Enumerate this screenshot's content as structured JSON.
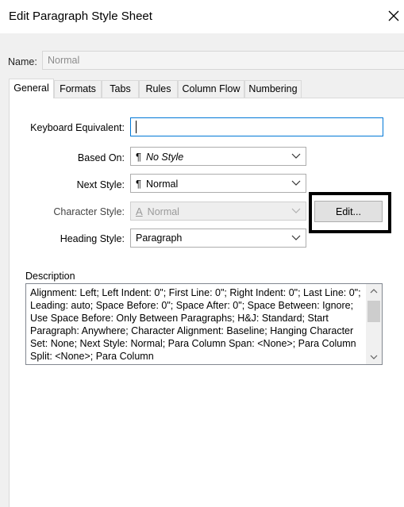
{
  "window": {
    "title": "Edit Paragraph Style Sheet",
    "close_icon": "close-icon"
  },
  "name": {
    "label": "Name:",
    "value": "Normal"
  },
  "tabs": [
    {
      "label": "General",
      "active": true
    },
    {
      "label": "Formats",
      "active": false
    },
    {
      "label": "Tabs",
      "active": false
    },
    {
      "label": "Rules",
      "active": false
    },
    {
      "label": "Column Flow",
      "active": false
    },
    {
      "label": "Numbering",
      "active": false
    }
  ],
  "general": {
    "keyboard_equivalent": {
      "label": "Keyboard Equivalent:",
      "value": ""
    },
    "based_on": {
      "label": "Based On:",
      "icon": "paragraph-icon",
      "value": "No Style"
    },
    "next_style": {
      "label": "Next Style:",
      "icon": "paragraph-icon",
      "value": "Normal"
    },
    "character_style": {
      "label": "Character Style:",
      "icon": "character-style-icon",
      "value": "Normal",
      "disabled": true
    },
    "edit_button": "Edit...",
    "heading_style": {
      "label": "Heading Style:",
      "value": "Paragraph"
    }
  },
  "description": {
    "label": "Description",
    "text": "Alignment: Left;   Left Indent: 0\";   First Line: 0\";   Right Indent: 0\";   Last Line: 0\";   Leading: auto;   Space Before: 0\";   Space After: 0\";   Space Between: Ignore;   Use Space Before: Only Between Paragraphs;   H&J: Standard;   Start Paragraph: Anywhere;   Character Alignment: Baseline;   Hanging Character Set: None;   Next Style: Normal;   Para Column Span: <None>;   Para Column Split: <None>;   Para Column"
  },
  "colors": {
    "focus_border": "#0078d7",
    "highlight_border": "#000000",
    "panel_background": "#ffffff",
    "window_background": "#f0f0f0"
  }
}
